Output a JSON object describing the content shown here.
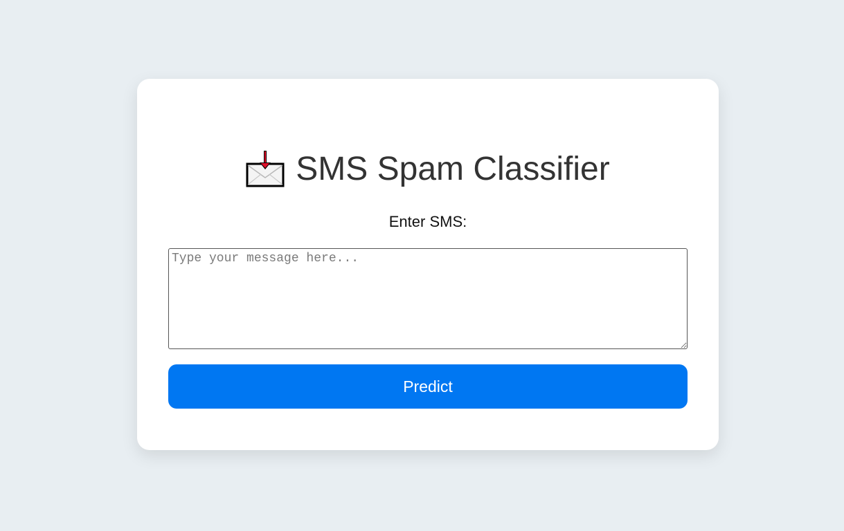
{
  "header": {
    "icon": "envelope-with-down-arrow-icon",
    "title": "SMS Spam Classifier"
  },
  "form": {
    "label": "Enter SMS:",
    "input_value": "",
    "input_placeholder": "Type your message here...",
    "predict_label": "Predict"
  },
  "colors": {
    "background": "#e8eef2",
    "card": "#ffffff",
    "button": "#0077f2",
    "title": "#333333",
    "icon_arrow": "#e0102a"
  }
}
